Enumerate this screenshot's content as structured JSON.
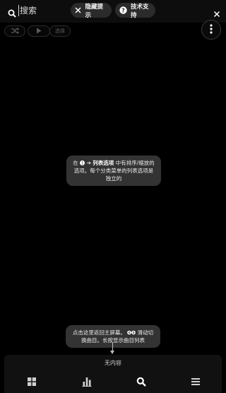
{
  "topbar": {
    "search_label": "搜索",
    "hide_tips_label": "隐藏提示",
    "tech_support_label": "技术支持"
  },
  "toolbar": {
    "select_label": "选择"
  },
  "tips": {
    "list_options": {
      "prefix": "在",
      "arrow": "➔",
      "bold": "列表选项",
      "rest": "中有排序/缩放的选项。每个分类菜单的列表选项是独立的"
    },
    "home": {
      "text": "点击这里返回主屏幕。",
      "rest": "滑动切换曲目。长按显示曲目列表"
    }
  },
  "bottom": {
    "empty_label": "无内容"
  }
}
